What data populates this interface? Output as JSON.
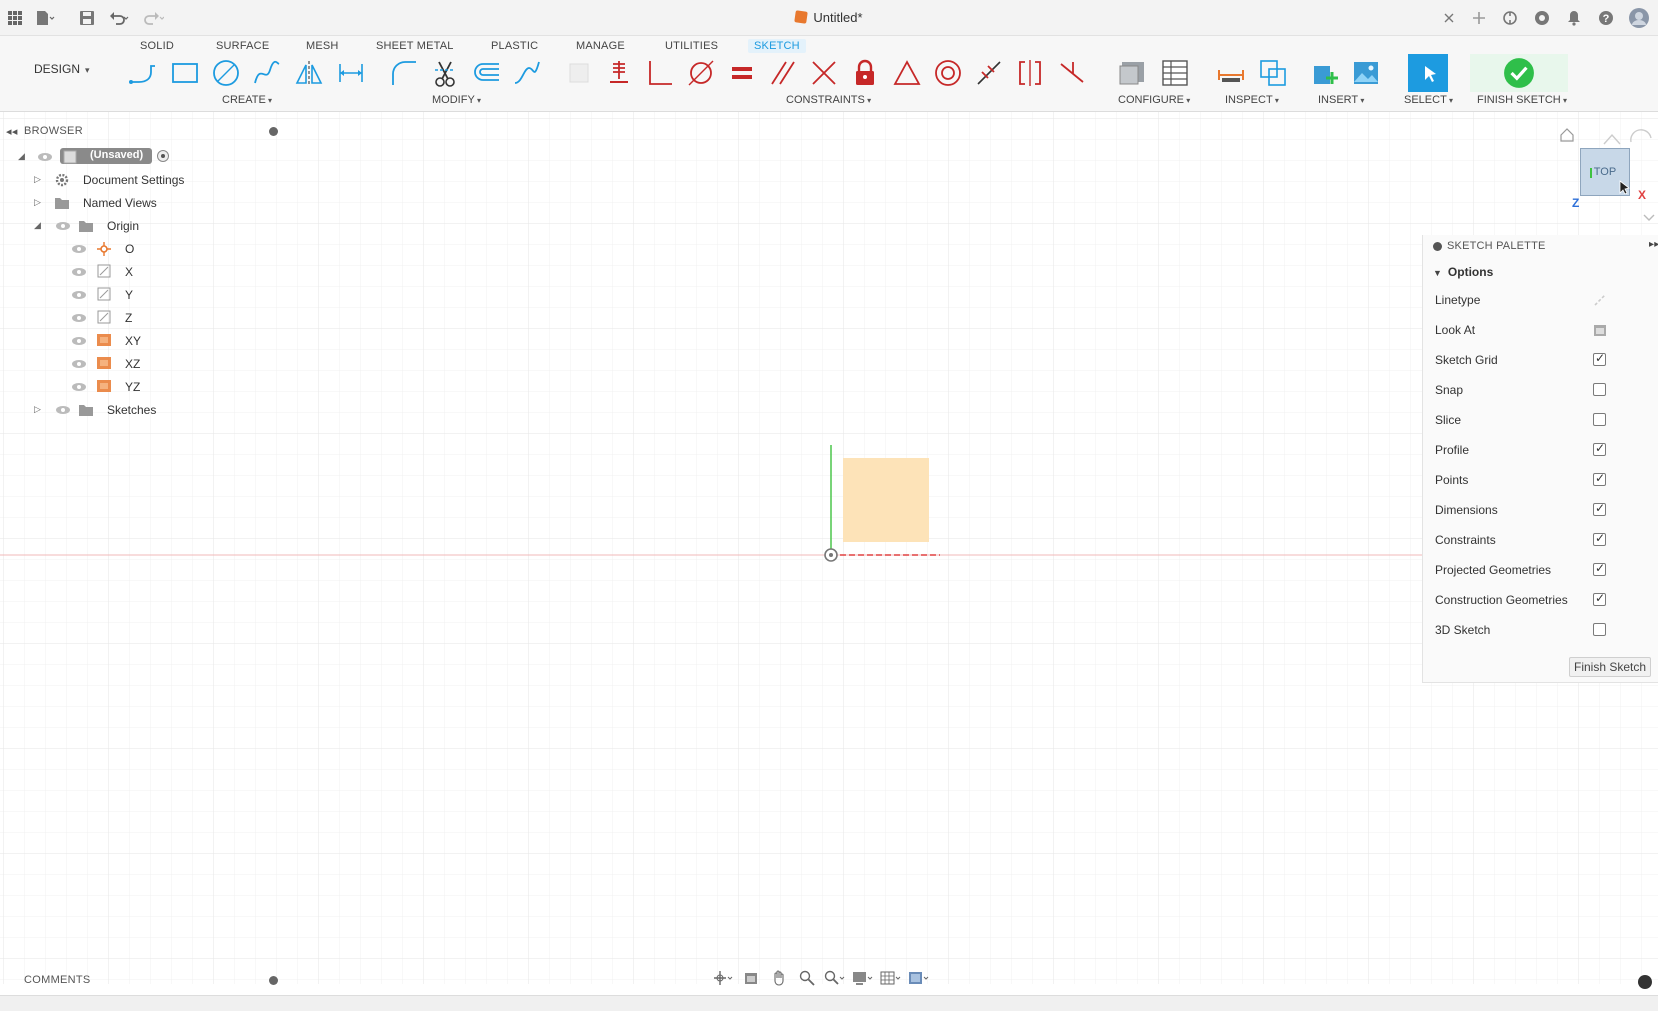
{
  "document": {
    "title": "Untitled*"
  },
  "tabs": [
    {
      "label": "SOLID"
    },
    {
      "label": "SURFACE"
    },
    {
      "label": "MESH"
    },
    {
      "label": "SHEET METAL"
    },
    {
      "label": "PLASTIC"
    },
    {
      "label": "MANAGE"
    },
    {
      "label": "UTILITIES"
    },
    {
      "label": "SKETCH",
      "active": true
    }
  ],
  "workspace": {
    "label": "DESIGN"
  },
  "groups": {
    "create": "CREATE",
    "modify": "MODIFY",
    "constraints": "CONSTRAINTS",
    "configure": "CONFIGURE",
    "inspect": "INSPECT",
    "insert": "INSERT",
    "select": "SELECT",
    "finish": "FINISH SKETCH"
  },
  "browser": {
    "title": "BROWSER",
    "root": "(Unsaved)",
    "items": [
      {
        "label": "Document Settings"
      },
      {
        "label": "Named Views"
      },
      {
        "label": "Origin"
      },
      {
        "label": "O"
      },
      {
        "label": "X"
      },
      {
        "label": "Y"
      },
      {
        "label": "Z"
      },
      {
        "label": "XY"
      },
      {
        "label": "XZ"
      },
      {
        "label": "YZ"
      },
      {
        "label": "Sketches"
      }
    ]
  },
  "viewcube": {
    "face": "TOP",
    "x_label": "X",
    "z_label": "Z"
  },
  "palette": {
    "title": "SKETCH PALETTE",
    "section": "Options",
    "rows": [
      {
        "label": "Linetype",
        "kind": "icon"
      },
      {
        "label": "Look At",
        "kind": "icon"
      },
      {
        "label": "Sketch Grid",
        "kind": "check",
        "checked": true
      },
      {
        "label": "Snap",
        "kind": "check",
        "checked": false
      },
      {
        "label": "Slice",
        "kind": "check",
        "checked": false
      },
      {
        "label": "Profile",
        "kind": "check",
        "checked": true
      },
      {
        "label": "Points",
        "kind": "check",
        "checked": true
      },
      {
        "label": "Dimensions",
        "kind": "check",
        "checked": true
      },
      {
        "label": "Constraints",
        "kind": "check",
        "checked": true
      },
      {
        "label": "Projected Geometries",
        "kind": "check",
        "checked": true
      },
      {
        "label": "Construction Geometries",
        "kind": "check",
        "checked": true
      },
      {
        "label": "3D Sketch",
        "kind": "check",
        "checked": false
      }
    ],
    "finish_button": "Finish Sketch"
  },
  "comments": {
    "title": "COMMENTS"
  },
  "colors": {
    "accent": "#1d9be0",
    "profile_fill": "#fde3b8",
    "x_axis": "#e04040",
    "y_axis": "#3fc23f",
    "constraint": "#c62828",
    "finish_green": "#2fbf4a"
  }
}
